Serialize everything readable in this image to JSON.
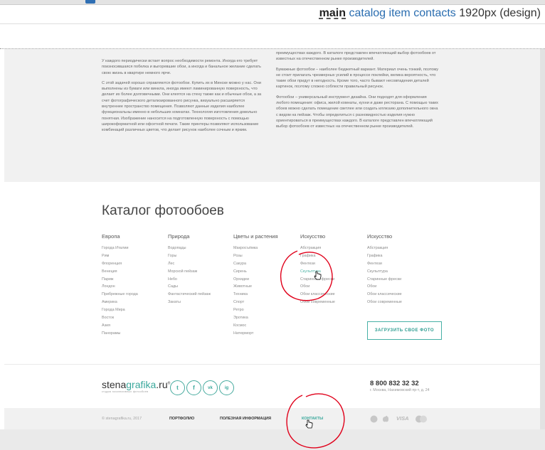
{
  "design_nav": {
    "main": "main",
    "links": [
      "catalog",
      "item",
      "contacts"
    ],
    "size": "1920px (design)"
  },
  "article": {
    "left": [
      "У каждого периодически встает вопрос необходимости ремонта. Иногда его требует поизносившаяся побелка и выгоревшие обои, а иногда и банальное желание сделать свою жизнь в квартире немного ярче.",
      "С этой задачей хорошо справляются фотообои. Купить их в Минске можно у нас. Они выполнены из бумаги или винила, иногда имеют ламинированную поверхность, что делает их более долговечными. Они клеятся на стену также как и обычные обои, а за счет фотографического детализированного рисунка, визуально расширяется внутреннее пространство помещения. Позволяют данные изделия наиболее функциональны именно в небольших комнатах. Технология изготовления довольно понятная. Изображение наносится на подготовленную поверхность с помощью широкоформатной или офсетной печати. Такие принтеры позволяют использование комбинаций различных цветов, что делает рисунок наиболее сочным и ярким."
    ],
    "right": [
      "преимуществах каждого. В каталоге представлен впечатляющий выбор фотообоев от известных на отечественном рынке производителей.",
      "Бумажные фотообои – наиболее бюджетный вариант. Материал очень тонкий, поэтому не стоит прилагать чрезмерных усилий в процессе поклейки, велика вероятность, что такие обои придут в негодность. Кроме того, часто бывают несовпадения деталей картинок, поэтому сложно соблюсти правильный рисунок.",
      "Фотообои – универсальный инструмент дизайна. Они подходят для оформления любого помещения: офиса, жилой комнаты, кухни и даже ресторана. С помощью таких обоев можно сделать помещение светлее или создать иллюзию дополнительного окна с видом на пейзаж. Чтобы определиться с разновидностью изделия нужно ориентироваться в преимуществах каждого. В каталоге представлен впечатляющий выбор фотообоев от известных на отечественном рынке производителей."
    ]
  },
  "catalog": {
    "title": "Каталог фотообоев",
    "upload_button": "ЗАГРУЗИТЬ СВОЕ ФОТО",
    "columns": [
      {
        "heading": "Европа",
        "items": [
          "Города Италии",
          "Рим",
          "Флоренция",
          "Венеция",
          "Париж",
          "Лондон",
          "Прибрежные города",
          "Америка",
          "Города Мира",
          "Восток",
          "Азия",
          "Панорамы"
        ]
      },
      {
        "heading": "Природа",
        "items": [
          "Водопады",
          "Горы",
          "Лес",
          "Морской пейзаж",
          "Небо",
          "Сады",
          "Фантастический пейзаж",
          "Закаты"
        ]
      },
      {
        "heading": "Цветы и растения",
        "items": [
          "Макросъёмка",
          "Розы",
          "Сакура",
          "Сирень",
          "Орхидеи",
          "Животные",
          "Техника",
          "Спорт",
          "Ретро",
          "Эротика",
          "Космос",
          "Натюрморт"
        ]
      },
      {
        "heading": "Искусство",
        "items": [
          "Абстракция",
          "Графика",
          "Фентези",
          "Скульптура",
          "Старинные фрески",
          "Обои",
          "Обои классические",
          "Обои современные"
        ]
      },
      {
        "heading": "Искусство",
        "items": [
          "Абстракция",
          "Графика",
          "Фентези",
          "Скульптура",
          "Старинные фрески",
          "Обои",
          "Обои классические",
          "Обои современные"
        ]
      }
    ],
    "hover_item": "Скульптура"
  },
  "footer": {
    "logo_main": "stena",
    "logo_accent": "grafika",
    "logo_tld": ".ru",
    "logo_reg": "®",
    "logo_sub": "студия эксклюзивных фотообоев",
    "social": [
      "t",
      "f",
      "vk",
      "ig"
    ],
    "phone": "8 800 832 32 32",
    "address": "г. Москва, Нахимовский пр-т, д. 24"
  },
  "subfooter": {
    "copyright": "© stenagrafika.ru, 2017",
    "links": [
      "ПОРТФОЛИО",
      "ПОЛЕЗНАЯ ИНФОРМАЦИЯ",
      "КОНТАКТЫ"
    ],
    "active_link": "КОНТАКТЫ",
    "payments": [
      "",
      "",
      "VISA",
      ""
    ]
  },
  "colors": {
    "accent": "#3aa89c",
    "nav_link": "#2a6db0",
    "annotation": "#e0001a"
  }
}
